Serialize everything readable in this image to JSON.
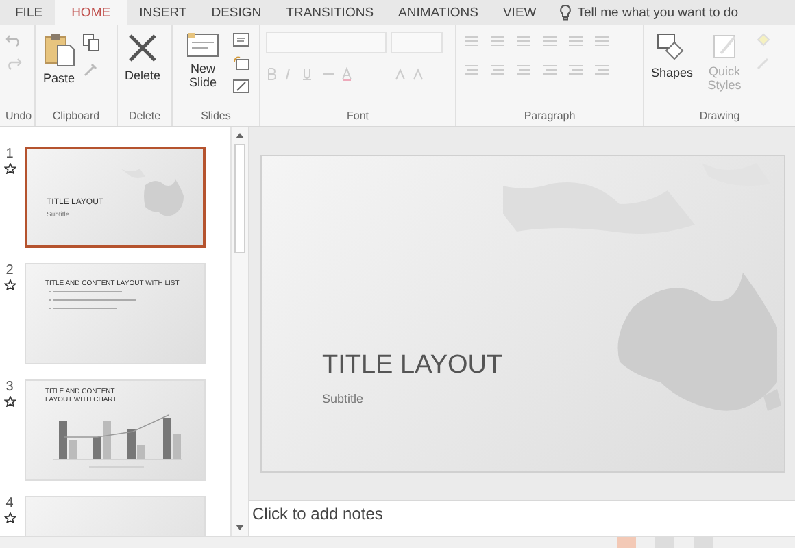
{
  "tabs": [
    {
      "label": "FILE",
      "selected": false
    },
    {
      "label": "HOME",
      "selected": true
    },
    {
      "label": "INSERT",
      "selected": false
    },
    {
      "label": "DESIGN",
      "selected": false
    },
    {
      "label": "TRANSITIONS",
      "selected": false
    },
    {
      "label": "ANIMATIONS",
      "selected": false
    },
    {
      "label": "VIEW",
      "selected": false
    }
  ],
  "tell_me": "Tell me what you want to do",
  "ribbon": {
    "groups": [
      {
        "kind": "undo",
        "label": "Undo"
      },
      {
        "kind": "clipboard",
        "label": "Clipboard",
        "button": "Paste"
      },
      {
        "kind": "delete",
        "label": "Delete",
        "button": "Delete"
      },
      {
        "kind": "slides",
        "label": "Slides",
        "button": "New Slide"
      },
      {
        "kind": "font",
        "label": "Font"
      },
      {
        "kind": "paragraph",
        "label": "Paragraph"
      },
      {
        "kind": "drawing",
        "label": "Drawing",
        "button": "Shapes",
        "button_2": "Quick Styles"
      }
    ]
  },
  "slides": [
    {
      "number": "1",
      "kind": "title",
      "title": "TITLE LAYOUT",
      "subtitle": "Subtitle",
      "selected": true
    },
    {
      "number": "2",
      "kind": "list",
      "title": "TITLE AND CONTENT LAYOUT WITH LIST",
      "selected": false
    },
    {
      "number": "3",
      "kind": "chart",
      "title": "TITLE AND CONTENT LAYOUT WITH CHART",
      "selected": false
    },
    {
      "number": "4",
      "kind": "cut",
      "selected": false
    }
  ],
  "current_slide": {
    "title": "TITLE LAYOUT",
    "subtitle": "Subtitle"
  },
  "notes": {
    "placeholder": "Click to add notes"
  }
}
